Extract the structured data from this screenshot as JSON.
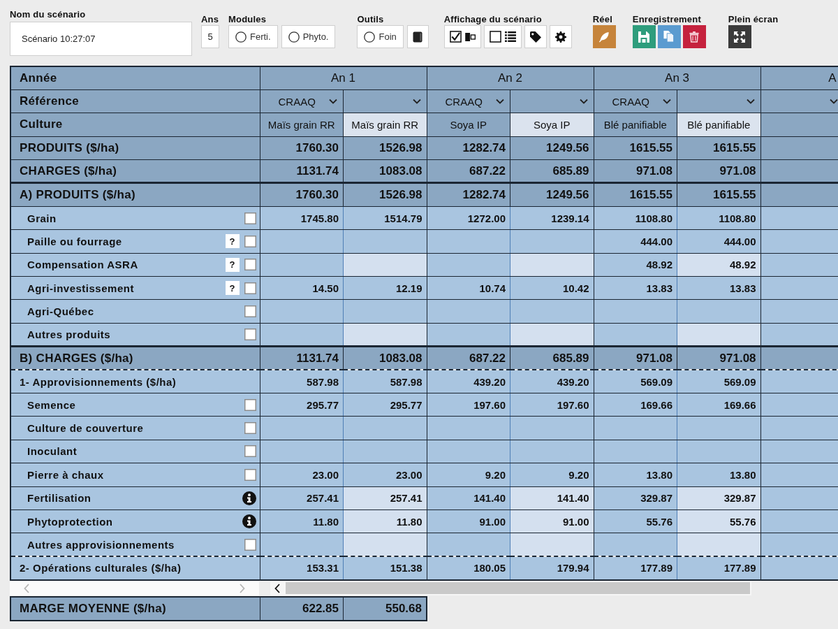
{
  "toolbar": [
    {
      "kind": "name",
      "label": "Nom du scénario",
      "value": "Scénario 10:27:07"
    },
    {
      "kind": "years",
      "label": "Ans",
      "value": "5"
    },
    {
      "kind": "modules",
      "label": "Modules",
      "options": [
        {
          "label": "Ferti.",
          "selected": false
        },
        {
          "label": "Phyto.",
          "selected": false
        }
      ]
    },
    {
      "kind": "tools",
      "label": "Outils",
      "options": [
        {
          "label": "Foin",
          "selected": false
        }
      ]
    },
    {
      "kind": "display",
      "label": "Affichage du scénario",
      "toggles": [
        {
          "checked": true
        },
        {
          "checked": false
        }
      ]
    },
    {
      "kind": "real",
      "label": "Réel"
    },
    {
      "kind": "saving",
      "label": "Enregistrement"
    },
    {
      "kind": "fullscreen",
      "label": "Plein écran"
    }
  ],
  "table": {
    "year_row": {
      "label": "Année"
    },
    "reference_row": {
      "label": "Référence"
    },
    "culture_row": {
      "label": "Culture",
      "editable": true
    },
    "years": [
      {
        "label": "An 1",
        "columns": [
          {
            "reference": "CRAAQ",
            "culture": "Maïs grain RR"
          },
          {
            "culture": "Maïs grain RR"
          }
        ]
      },
      {
        "label": "An 2",
        "columns": [
          {
            "reference": "CRAAQ",
            "culture": "Soya IP"
          },
          {
            "culture": "Soya IP"
          }
        ]
      },
      {
        "label": "An 3",
        "columns": [
          {
            "reference": "CRAAQ",
            "culture": "Blé panifiable"
          },
          {
            "culture": "Blé panifiable"
          }
        ]
      },
      {
        "label": "A",
        "columns": [
          {}
        ]
      }
    ],
    "rows": [
      {
        "kind": "summary",
        "label": "PRODUITS ($/ha)",
        "cells": [
          {
            "value": "1760.30",
            "editable": false
          },
          {
            "value": "1526.98",
            "editable": false
          },
          {
            "value": "1282.74",
            "editable": false
          },
          {
            "value": "1249.56",
            "editable": false
          },
          {
            "value": "1615.55",
            "editable": false
          },
          {
            "value": "1615.55",
            "editable": false
          }
        ]
      },
      {
        "kind": "summary",
        "label": "CHARGES ($/ha)",
        "cells": [
          {
            "value": "1131.74",
            "editable": false
          },
          {
            "value": "1083.08",
            "editable": false
          },
          {
            "value": "687.22",
            "editable": false
          },
          {
            "value": "685.89",
            "editable": false
          },
          {
            "value": "971.08",
            "editable": false
          },
          {
            "value": "971.08",
            "editable": false
          }
        ]
      },
      {
        "kind": "section",
        "label": "A) PRODUITS ($/ha)",
        "cells": [
          {
            "value": "1760.30",
            "editable": false
          },
          {
            "value": "1526.98",
            "editable": false
          },
          {
            "value": "1282.74",
            "editable": false
          },
          {
            "value": "1249.56",
            "editable": false
          },
          {
            "value": "1615.55",
            "editable": false
          },
          {
            "value": "1615.55",
            "editable": false
          }
        ]
      },
      {
        "kind": "item",
        "label": "Grain",
        "checked": false,
        "cells": [
          {
            "value": "1745.80",
            "editable": false
          },
          {
            "value": "1514.79",
            "editable": false
          },
          {
            "value": "1272.00",
            "editable": false
          },
          {
            "value": "1239.14",
            "editable": false
          },
          {
            "value": "1108.80",
            "editable": false
          },
          {
            "value": "1108.80",
            "editable": false
          }
        ]
      },
      {
        "kind": "item",
        "label": "Paille ou fourrage",
        "help": "?",
        "checked": false,
        "cells": [
          {
            "editable": false
          },
          {
            "editable": false
          },
          {
            "editable": false
          },
          {
            "editable": false
          },
          {
            "value": "444.00",
            "editable": false
          },
          {
            "value": "444.00",
            "editable": false
          }
        ]
      },
      {
        "kind": "item",
        "label": "Compensation ASRA",
        "help": "?",
        "checked": false,
        "cells": [
          {
            "editable": false
          },
          {
            "editable": true
          },
          {
            "editable": false
          },
          {
            "editable": true
          },
          {
            "value": "48.92",
            "editable": false
          },
          {
            "value": "48.92",
            "editable": true
          }
        ]
      },
      {
        "kind": "item",
        "label": "Agri-investissement",
        "help": "?",
        "checked": false,
        "cells": [
          {
            "value": "14.50",
            "editable": false
          },
          {
            "value": "12.19",
            "editable": false
          },
          {
            "value": "10.74",
            "editable": false
          },
          {
            "value": "10.42",
            "editable": false
          },
          {
            "value": "13.83",
            "editable": false
          },
          {
            "value": "13.83",
            "editable": false
          }
        ]
      },
      {
        "kind": "item",
        "label": "Agri-Québec",
        "checked": false,
        "cells": [
          {
            "editable": false
          },
          {
            "editable": false
          },
          {
            "editable": false
          },
          {
            "editable": false
          },
          {
            "editable": false
          },
          {
            "editable": false
          }
        ]
      },
      {
        "kind": "item",
        "label": "Autres produits",
        "checked": false,
        "cells": [
          {
            "editable": false
          },
          {
            "editable": true
          },
          {
            "editable": false
          },
          {
            "editable": true
          },
          {
            "editable": false
          },
          {
            "editable": true
          }
        ]
      },
      {
        "kind": "section",
        "label": "B) CHARGES ($/ha)",
        "cells": [
          {
            "value": "1131.74",
            "editable": false
          },
          {
            "value": "1083.08",
            "editable": false
          },
          {
            "value": "687.22",
            "editable": false
          },
          {
            "value": "685.89",
            "editable": false
          },
          {
            "value": "971.08",
            "editable": false
          },
          {
            "value": "971.08",
            "editable": false
          }
        ]
      },
      {
        "kind": "subtotal",
        "label": "1- Approvisionnements ($/ha)",
        "cells": [
          {
            "value": "587.98",
            "editable": false
          },
          {
            "value": "587.98",
            "editable": false
          },
          {
            "value": "439.20",
            "editable": false
          },
          {
            "value": "439.20",
            "editable": false
          },
          {
            "value": "569.09",
            "editable": false
          },
          {
            "value": "569.09",
            "editable": false
          }
        ]
      },
      {
        "kind": "item",
        "label": "Semence",
        "checked": false,
        "cells": [
          {
            "value": "295.77",
            "editable": false
          },
          {
            "value": "295.77",
            "editable": false
          },
          {
            "value": "197.60",
            "editable": false
          },
          {
            "value": "197.60",
            "editable": false
          },
          {
            "value": "169.66",
            "editable": false
          },
          {
            "value": "169.66",
            "editable": false
          }
        ]
      },
      {
        "kind": "item",
        "label": "Culture de couverture",
        "checked": false,
        "cells": [
          {
            "editable": false
          },
          {
            "editable": false
          },
          {
            "editable": false
          },
          {
            "editable": false
          },
          {
            "editable": false
          },
          {
            "editable": false
          }
        ]
      },
      {
        "kind": "item",
        "label": "Inoculant",
        "checked": false,
        "cells": [
          {
            "editable": false
          },
          {
            "editable": false
          },
          {
            "editable": false
          },
          {
            "editable": false
          },
          {
            "editable": false
          },
          {
            "editable": false
          }
        ]
      },
      {
        "kind": "item",
        "label": "Pierre à chaux",
        "checked": false,
        "cells": [
          {
            "value": "23.00",
            "editable": false
          },
          {
            "value": "23.00",
            "editable": false
          },
          {
            "value": "9.20",
            "editable": false
          },
          {
            "value": "9.20",
            "editable": false
          },
          {
            "value": "13.80",
            "editable": false
          },
          {
            "value": "13.80",
            "editable": false
          }
        ]
      },
      {
        "kind": "info",
        "label": "Fertilisation",
        "cells": [
          {
            "value": "257.41",
            "editable": false
          },
          {
            "value": "257.41",
            "editable": true
          },
          {
            "value": "141.40",
            "editable": false
          },
          {
            "value": "141.40",
            "editable": true
          },
          {
            "value": "329.87",
            "editable": false
          },
          {
            "value": "329.87",
            "editable": true
          }
        ]
      },
      {
        "kind": "info",
        "label": "Phytoprotection",
        "cells": [
          {
            "value": "11.80",
            "editable": false
          },
          {
            "value": "11.80",
            "editable": true
          },
          {
            "value": "91.00",
            "editable": false
          },
          {
            "value": "91.00",
            "editable": true
          },
          {
            "value": "55.76",
            "editable": false
          },
          {
            "value": "55.76",
            "editable": true
          }
        ]
      },
      {
        "kind": "item",
        "label": "Autres approvisionnements",
        "checked": false,
        "cells": [
          {
            "editable": false
          },
          {
            "editable": true
          },
          {
            "editable": false
          },
          {
            "editable": true
          },
          {
            "editable": false
          },
          {
            "editable": true
          }
        ]
      },
      {
        "kind": "subtotal",
        "label": "2- Opérations culturales ($/ha)",
        "cells": [
          {
            "value": "153.31",
            "editable": false
          },
          {
            "value": "151.38",
            "editable": false
          },
          {
            "value": "180.05",
            "editable": false
          },
          {
            "value": "179.94",
            "editable": false
          },
          {
            "value": "177.89",
            "editable": false
          },
          {
            "value": "177.89",
            "editable": false
          }
        ]
      }
    ]
  },
  "footer": {
    "label": "MARGE MOYENNE ($/ha)",
    "values": [
      "622.85",
      "550.68"
    ]
  }
}
